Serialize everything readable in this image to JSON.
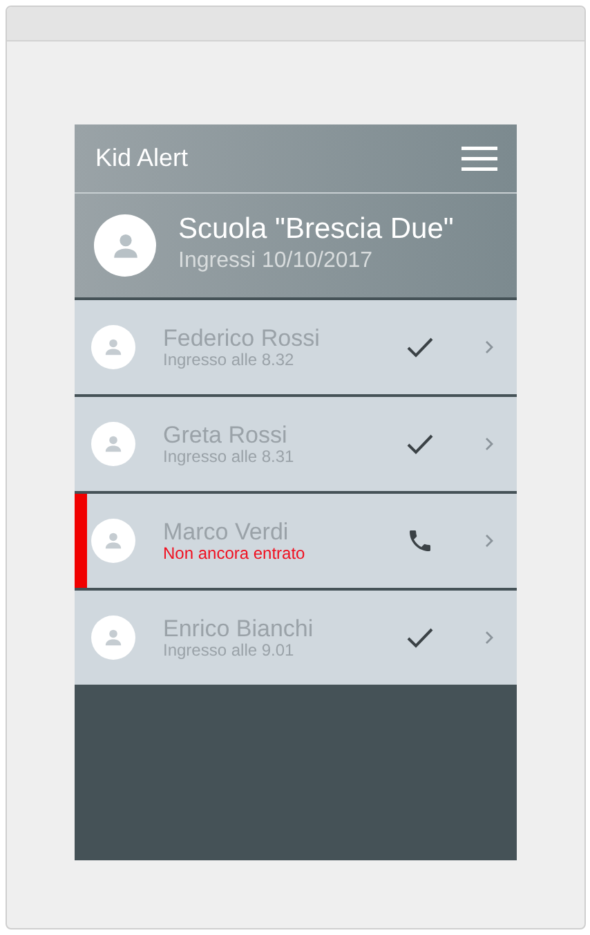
{
  "app": {
    "title": "Kid Alert"
  },
  "school": {
    "name": "Scuola \"Brescia Due\"",
    "subtitle": "Ingressi 10/10/2017"
  },
  "students": [
    {
      "name": "Federico Rossi",
      "status": "Ingresso alle 8.32",
      "kind": "entered"
    },
    {
      "name": "Greta Rossi",
      "status": "Ingresso alle 8.31",
      "kind": "entered"
    },
    {
      "name": "Marco Verdi",
      "status": "Non ancora entrato",
      "kind": "missing"
    },
    {
      "name": "Enrico Bianchi",
      "status": "Ingresso alle 9.01",
      "kind": "entered"
    }
  ]
}
